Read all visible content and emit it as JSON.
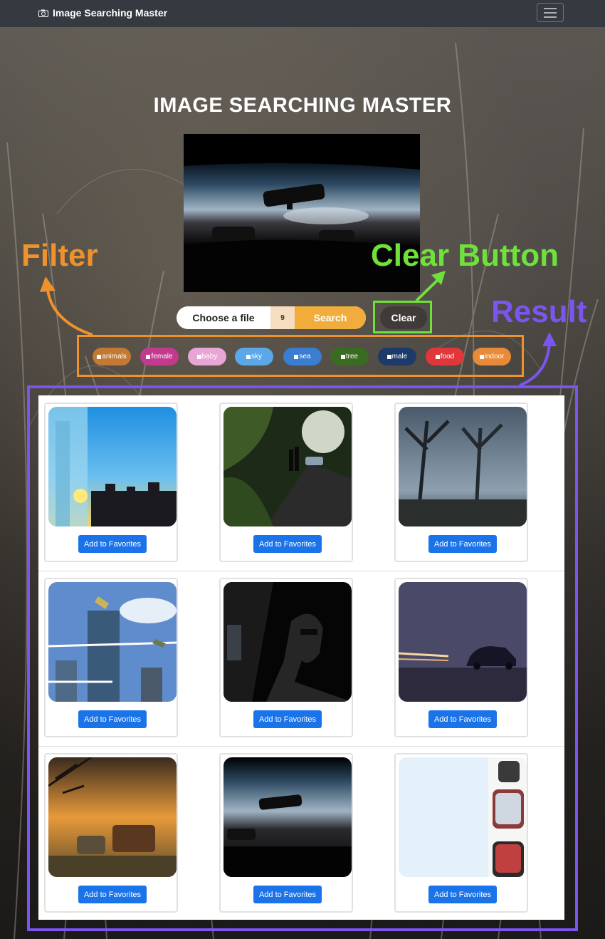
{
  "navbar": {
    "brand": "Image Searching Master",
    "brand_icon": "camera-icon",
    "menu_icon": "hamburger-menu-icon"
  },
  "hero": {
    "title": "IMAGE SEARCHING MASTER"
  },
  "upload": {
    "choose_label": "Choose a file",
    "file_count": "9",
    "search_label": "Search",
    "clear_label": "Clear"
  },
  "filters": [
    {
      "label": "animals",
      "color": "#c27a33"
    },
    {
      "label": "female",
      "color": "#c23a8e"
    },
    {
      "label": "baby",
      "color": "#e8a6d4"
    },
    {
      "label": "sky",
      "color": "#5aa7ea"
    },
    {
      "label": "sea",
      "color": "#3a7dd1"
    },
    {
      "label": "tree",
      "color": "#3a6b22"
    },
    {
      "label": "male",
      "color": "#1d3a6b"
    },
    {
      "label": "food",
      "color": "#e0383a"
    },
    {
      "label": "indoor",
      "color": "#e88a38"
    }
  ],
  "results": {
    "button_label": "Add to Favorites",
    "images": [
      {
        "scene": "glass-city-sunset"
      },
      {
        "scene": "street-sunlight-people"
      },
      {
        "scene": "blurred-trees-dusk"
      },
      {
        "scene": "airshow-tower"
      },
      {
        "scene": "man-in-car"
      },
      {
        "scene": "car-light-trails"
      },
      {
        "scene": "abandoned-buses-sunset"
      },
      {
        "scene": "windshield-mirror-dusk"
      },
      {
        "scene": "side-mirror-bright"
      }
    ]
  },
  "annotations": {
    "filter_label": "Filter",
    "clear_label": "Clear Button",
    "result_label": "Result",
    "colors": {
      "filter": "#f0922b",
      "clear": "#6ee23a",
      "result": "#7b55f0"
    }
  }
}
